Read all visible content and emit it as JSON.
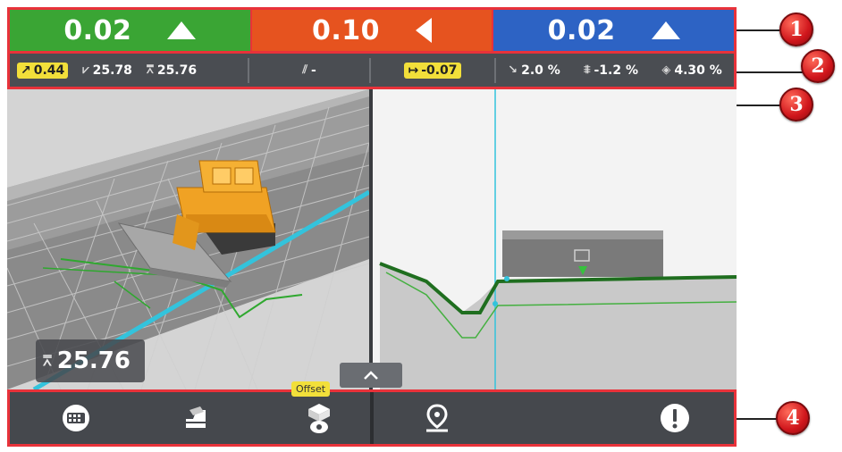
{
  "guidance": {
    "left": {
      "value": "0.02",
      "direction": "up",
      "color": "#3aa534"
    },
    "center": {
      "value": "0.10",
      "direction": "left",
      "color": "#e6531f"
    },
    "right": {
      "value": "0.02",
      "direction": "up",
      "color": "#2d63c4"
    }
  },
  "status": {
    "blade_angle": "0.44",
    "design_elevation": "25.78",
    "current_elevation": "25.76",
    "crossfall": "-",
    "offset": "-0.07",
    "mainfall": "2.0 %",
    "cross_slope": "-1.2 %",
    "grade": "4.30 %"
  },
  "view": {
    "elevation_readout": "25.76"
  },
  "toolbar": {
    "offset_label": "Offset"
  },
  "callouts": [
    "1",
    "2",
    "3",
    "4"
  ],
  "colors": {
    "callout": "#d0161c",
    "highlight_border": "#e8323a",
    "badge": "#f2df3a"
  }
}
